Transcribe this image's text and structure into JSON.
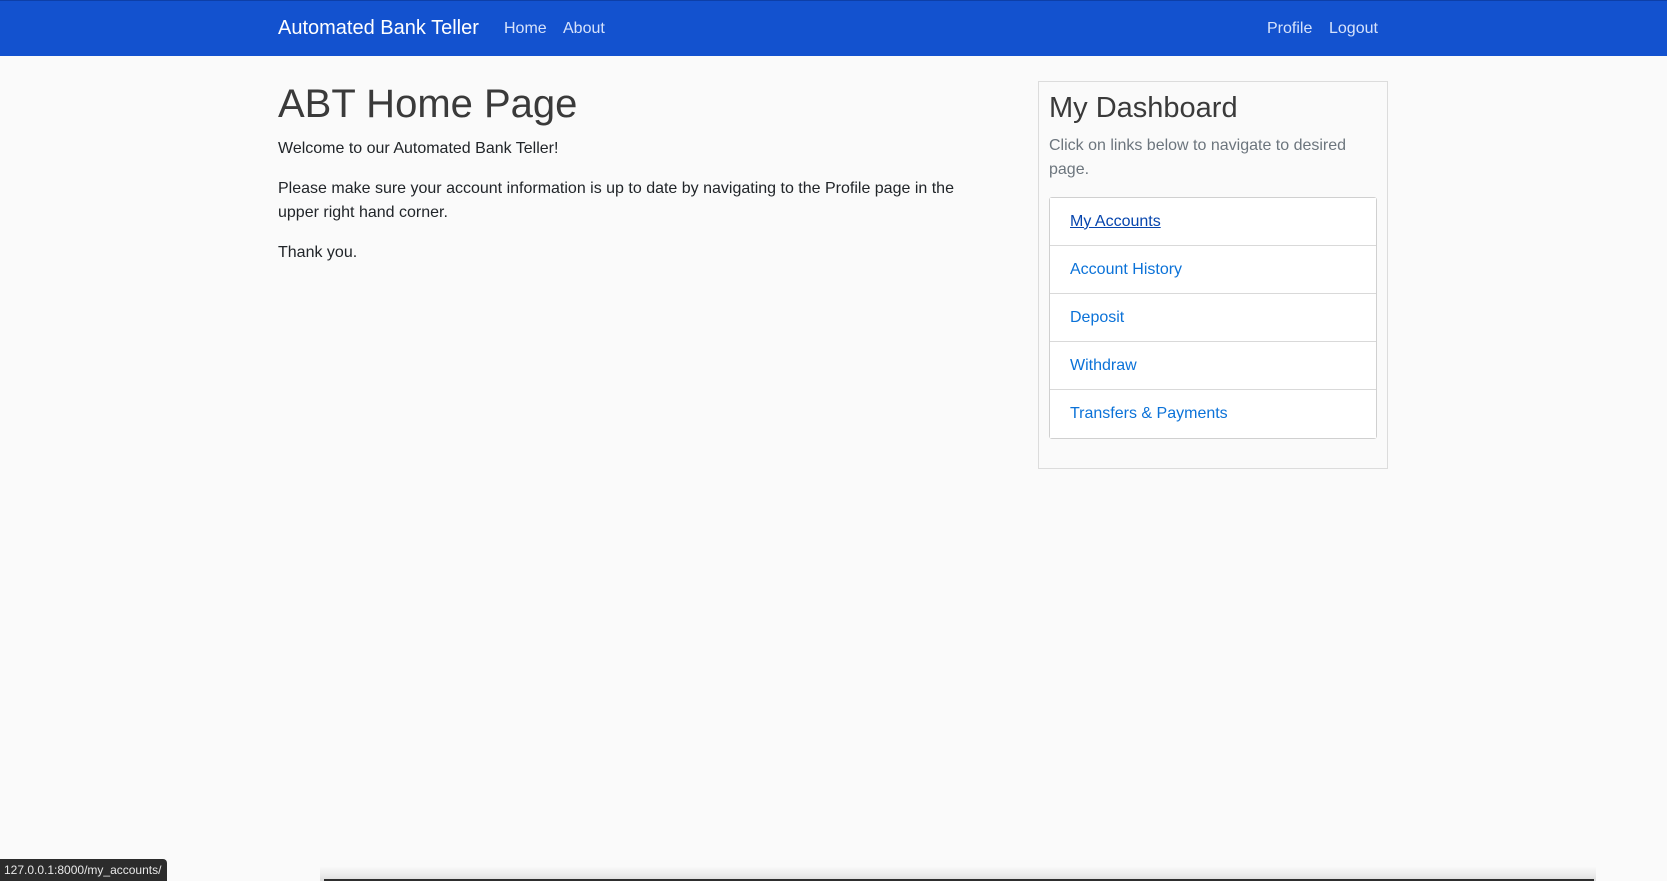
{
  "navbar": {
    "brand": "Automated Bank Teller",
    "left_links": [
      "Home",
      "About"
    ],
    "right_links": [
      "Profile",
      "Logout"
    ]
  },
  "main": {
    "title": "ABT Home Page",
    "welcome": "Welcome to our Automated Bank Teller!",
    "info": "Please make sure your account information is up to date by navigating to the Profile page in the upper right hand corner.",
    "thanks": "Thank you."
  },
  "dashboard": {
    "title": "My Dashboard",
    "subtitle": "Click on links below to navigate to desired page.",
    "links": [
      "My Accounts",
      "Account History",
      "Deposit",
      "Withdraw",
      "Transfers & Payments"
    ],
    "hovered_link": "My Accounts"
  },
  "status_bar": {
    "url": "127.0.0.1:8000/my_accounts/"
  },
  "colors": {
    "navbar": "#1352cf",
    "link": "#0b72d8",
    "background": "#fafafa"
  }
}
